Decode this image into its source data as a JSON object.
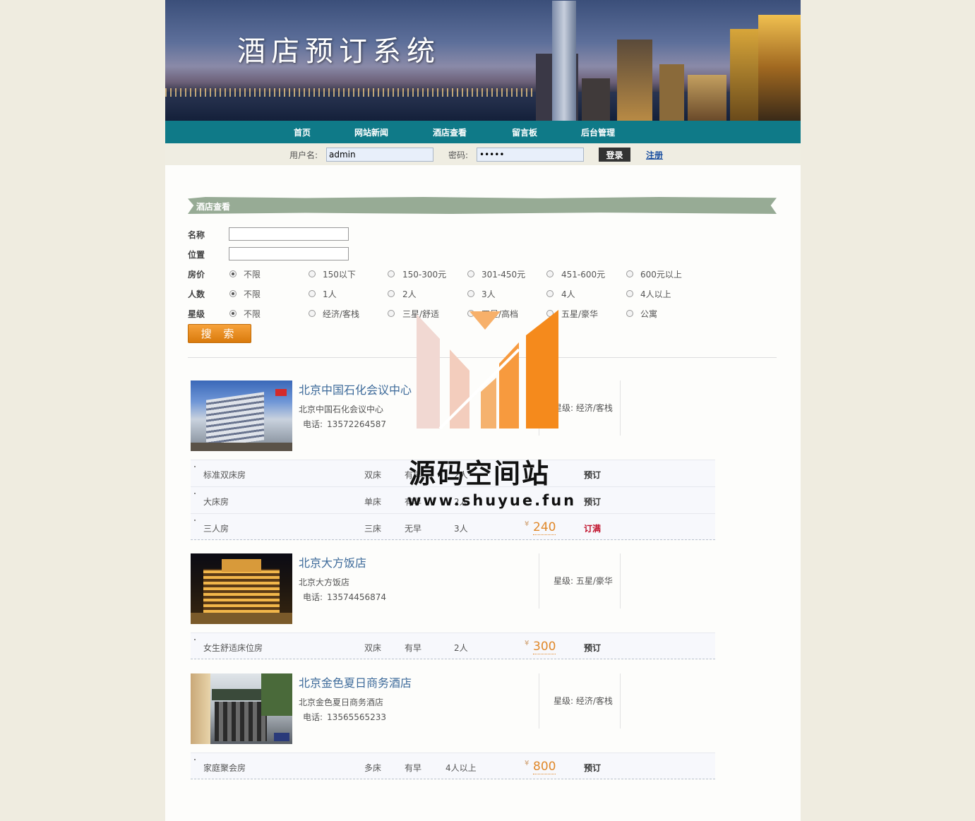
{
  "banner": {
    "title": "酒店预订系统"
  },
  "nav": {
    "items": [
      "首页",
      "网站新闻",
      "酒店查看",
      "留言板",
      "后台管理"
    ]
  },
  "login": {
    "username_label": "用户名:",
    "username_value": "admin",
    "password_label": "密码:",
    "password_value": "•••••",
    "login_button": "登录",
    "register_link": "注册"
  },
  "section": {
    "title": "酒店查看"
  },
  "search": {
    "name_label": "名称",
    "location_label": "位置",
    "price_label": "房价",
    "price_options": [
      "不限",
      "150以下",
      "150-300元",
      "301-450元",
      "451-600元",
      "600元以上"
    ],
    "people_label": "人数",
    "people_options": [
      "不限",
      "1人",
      "2人",
      "3人",
      "4人",
      "4人以上"
    ],
    "star_label": "星级",
    "star_options": [
      "不限",
      "经济/客栈",
      "三星/舒适",
      "四星/高档",
      "五星/豪华",
      "公寓"
    ],
    "selected": {
      "price": "不限",
      "people": "不限",
      "star": "不限"
    },
    "button": "搜 索"
  },
  "hotels": [
    {
      "name": "北京中国石化会议中心",
      "address": "北京中国石化会议中心",
      "tel_label": "电话:",
      "tel": "13572264587",
      "star": "星级: 经济/客栈",
      "rooms": [
        {
          "type": "标准双床房",
          "bed": "双床",
          "breakfast": "有早",
          "people": "2人",
          "price": "",
          "action": "预订"
        },
        {
          "type": "大床房",
          "bed": "单床",
          "breakfast": "有早",
          "people": "2人",
          "price": "",
          "action": "预订"
        },
        {
          "type": "三人房",
          "bed": "三床",
          "breakfast": "无早",
          "people": "3人",
          "price": "240",
          "action": "订满"
        }
      ]
    },
    {
      "name": "北京大方饭店",
      "address": "北京大方饭店",
      "tel_label": "电话:",
      "tel": "13574456874",
      "star": "星级: 五星/豪华",
      "rooms": [
        {
          "type": "女生舒适床位房",
          "bed": "双床",
          "breakfast": "有早",
          "people": "2人",
          "price": "300",
          "action": "预订"
        }
      ]
    },
    {
      "name": "北京金色夏日商务酒店",
      "address": "北京金色夏日商务酒店",
      "tel_label": "电话:",
      "tel": "13565565233",
      "star": "星级: 经济/客栈",
      "rooms": [
        {
          "type": "家庭聚会房",
          "bed": "多床",
          "breakfast": "有早",
          "people": "4人以上",
          "price": "800",
          "action": "预订"
        }
      ]
    }
  ],
  "currency": "¥",
  "watermark": {
    "line1": "源码空间站",
    "line2": "www.shuyue.fun"
  },
  "colors": {
    "nav": "#0f7a88",
    "section": "#97ab95",
    "price": "#e0882a",
    "full": "#c0102a",
    "search_button": "#e88a1a"
  }
}
